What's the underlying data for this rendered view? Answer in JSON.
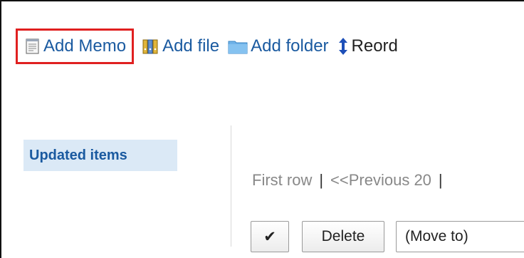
{
  "toolbar": {
    "add_memo": "Add Memo",
    "add_file": "Add file",
    "add_folder": "Add folder",
    "reorder": "Reord"
  },
  "sidebar": {
    "updated_items": "Updated items"
  },
  "pager": {
    "first_row": "First row",
    "separator": "|",
    "previous": "<<Previous 20"
  },
  "actions": {
    "check_all": "✔",
    "delete": "Delete",
    "move_to": "(Move to)"
  },
  "colors": {
    "link": "#1a5aa0",
    "highlight_border": "#e02020",
    "side_bg": "#dbe9f6"
  },
  "icons": [
    "memo-icon",
    "file-icon",
    "folder-icon",
    "reorder-icon"
  ]
}
